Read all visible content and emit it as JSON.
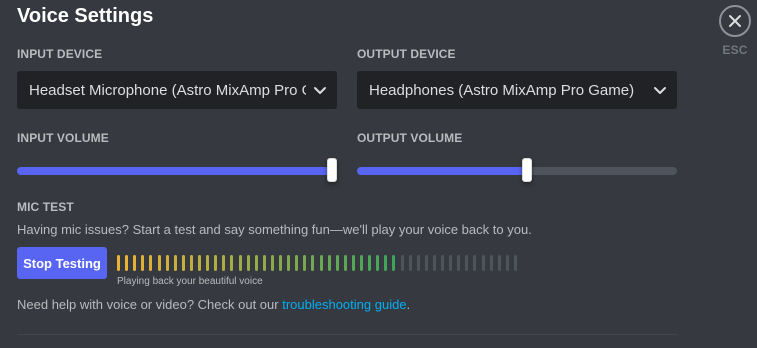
{
  "header": {
    "title": "Voice Settings",
    "esc_label": "ESC",
    "close_icon": "close-icon"
  },
  "input_device": {
    "label": "INPUT DEVICE",
    "value": "Headset Microphone (Astro MixAmp Pro Game)"
  },
  "output_device": {
    "label": "OUTPUT DEVICE",
    "value": "Headphones (Astro MixAmp Pro Game)"
  },
  "input_volume": {
    "label": "INPUT VOLUME",
    "percent": 100
  },
  "output_volume": {
    "label": "OUTPUT VOLUME",
    "percent": 53
  },
  "mic_test": {
    "label": "MIC TEST",
    "description": "Having mic issues? Start a test and say something fun—we'll play your voice back to you.",
    "button_label": "Stop Testing",
    "playback_text": "Playing back your beautiful voice",
    "meter": {
      "total_bars": 50,
      "active_bars": 35
    }
  },
  "help": {
    "text": "Need help with voice or video? Check out our ",
    "link_text": "troubleshooting guide",
    "suffix": "."
  },
  "colors": {
    "background": "#36393f",
    "accent": "#5865f2",
    "link": "#00b0f4",
    "meter_start": "#f0b232",
    "meter_end": "#3ba55c",
    "meter_inactive": "#4f545c"
  }
}
